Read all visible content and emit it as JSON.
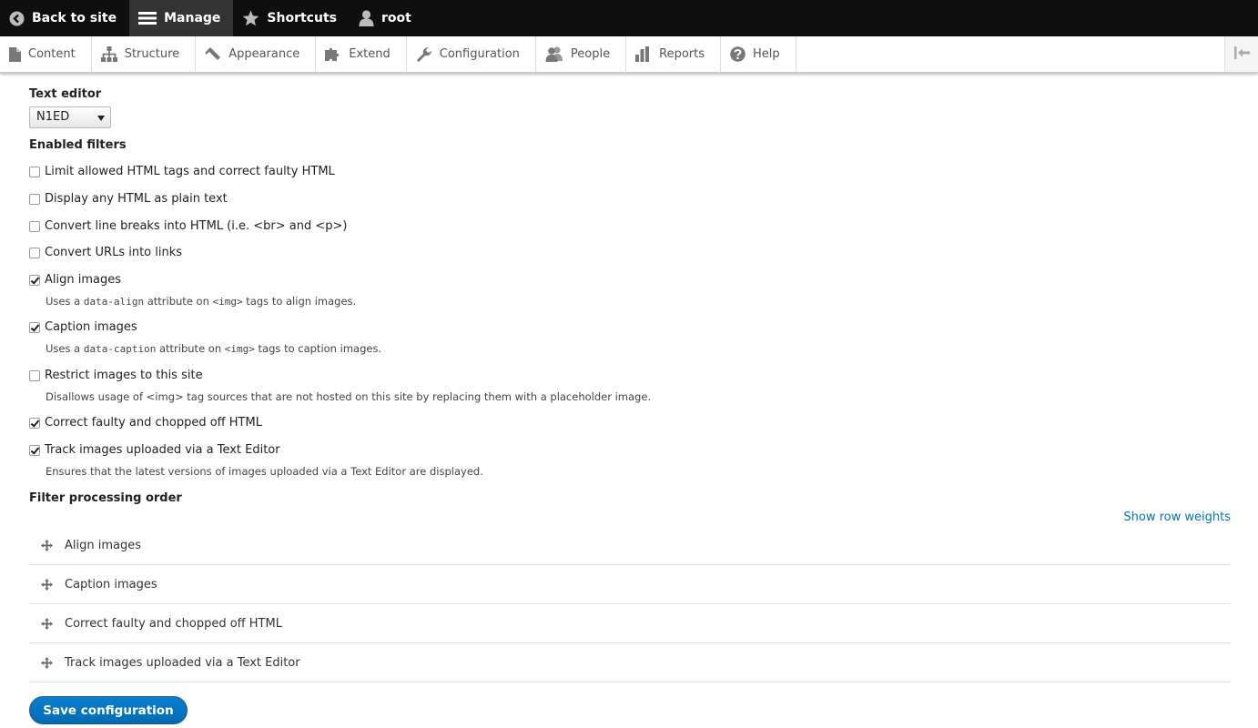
{
  "toolbar": {
    "back": "Back to site",
    "manage": "Manage",
    "shortcuts": "Shortcuts",
    "user": "root"
  },
  "tray": {
    "content": "Content",
    "structure": "Structure",
    "appearance": "Appearance",
    "extend": "Extend",
    "configuration": "Configuration",
    "people": "People",
    "reports": "Reports",
    "help": "Help"
  },
  "form": {
    "editor_label": "Text editor",
    "editor_value": "N1ED",
    "filters_label": "Enabled filters",
    "filters": [
      {
        "label": "Limit allowed HTML tags and correct faulty HTML",
        "checked": false
      },
      {
        "label": "Display any HTML as plain text",
        "checked": false
      },
      {
        "label": "Convert line breaks into HTML (i.e. <br> and <p>)",
        "checked": false
      },
      {
        "label": "Convert URLs into links",
        "checked": false
      },
      {
        "label": "Align images",
        "checked": true
      },
      {
        "label": "Caption images",
        "checked": true
      },
      {
        "label": "Restrict images to this site",
        "checked": false
      },
      {
        "label": "Correct faulty and chopped off HTML",
        "checked": true
      },
      {
        "label": "Track images uploaded via a Text Editor",
        "checked": true
      }
    ],
    "desc_align": {
      "pre": "Uses a ",
      "code1": "data-align",
      "mid": " attribute on ",
      "code2": "<img>",
      "post": " tags to align images."
    },
    "desc_caption": {
      "pre": "Uses a ",
      "code1": "data-caption",
      "mid": " attribute on ",
      "code2": "<img>",
      "post": " tags to caption images."
    },
    "desc_restrict": "Disallows usage of <img> tag sources that are not hosted on this site by replacing them with a placeholder image.",
    "desc_track": "Ensures that the latest versions of images uploaded via a Text Editor are displayed.",
    "order_label": "Filter processing order",
    "show_weights": "Show row weights",
    "order": [
      "Align images",
      "Caption images",
      "Correct faulty and chopped off HTML",
      "Track images uploaded via a Text Editor"
    ],
    "save": "Save configuration"
  }
}
